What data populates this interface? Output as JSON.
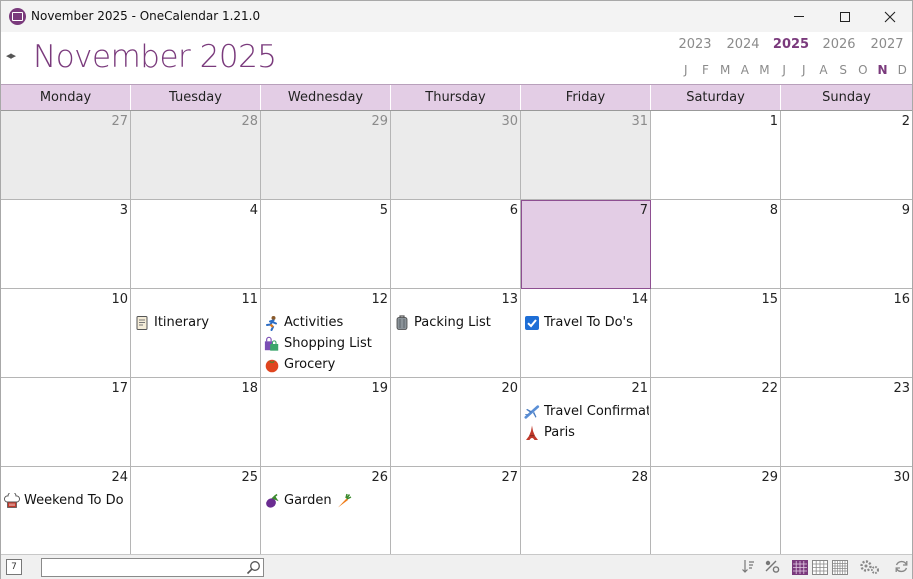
{
  "window": {
    "title": "November 2025 - OneCalendar 1.21.0"
  },
  "header": {
    "month_title": "November 2025",
    "nav_arrows": "◂▸",
    "years": [
      {
        "label": "2023",
        "active": false
      },
      {
        "label": "2024",
        "active": false
      },
      {
        "label": "2025",
        "active": true
      },
      {
        "label": "2026",
        "active": false
      },
      {
        "label": "2027",
        "active": false
      }
    ],
    "months": [
      {
        "label": "J",
        "active": false
      },
      {
        "label": "F",
        "active": false
      },
      {
        "label": "M",
        "active": false
      },
      {
        "label": "A",
        "active": false
      },
      {
        "label": "M",
        "active": false
      },
      {
        "label": "J",
        "active": false
      },
      {
        "label": "J",
        "active": false
      },
      {
        "label": "A",
        "active": false
      },
      {
        "label": "S",
        "active": false
      },
      {
        "label": "O",
        "active": false
      },
      {
        "label": "N",
        "active": true
      },
      {
        "label": "D",
        "active": false
      }
    ]
  },
  "weekdays": [
    "Monday",
    "Tuesday",
    "Wednesday",
    "Thursday",
    "Friday",
    "Saturday",
    "Sunday"
  ],
  "weeks": [
    [
      {
        "day": "27",
        "other": true,
        "events": []
      },
      {
        "day": "28",
        "other": true,
        "events": []
      },
      {
        "day": "29",
        "other": true,
        "events": []
      },
      {
        "day": "30",
        "other": true,
        "events": []
      },
      {
        "day": "31",
        "other": true,
        "events": []
      },
      {
        "day": "1",
        "other": false,
        "events": []
      },
      {
        "day": "2",
        "other": false,
        "events": []
      }
    ],
    [
      {
        "day": "3",
        "other": false,
        "events": []
      },
      {
        "day": "4",
        "other": false,
        "events": []
      },
      {
        "day": "5",
        "other": false,
        "events": []
      },
      {
        "day": "6",
        "other": false,
        "events": []
      },
      {
        "day": "7",
        "other": false,
        "today": true,
        "events": []
      },
      {
        "day": "8",
        "other": false,
        "events": []
      },
      {
        "day": "9",
        "other": false,
        "events": []
      }
    ],
    [
      {
        "day": "10",
        "other": false,
        "events": []
      },
      {
        "day": "11",
        "other": false,
        "events": [
          {
            "icon": "scroll-icon",
            "label": "Itinerary"
          }
        ]
      },
      {
        "day": "12",
        "other": false,
        "events": [
          {
            "icon": "runner-icon",
            "label": "Activities"
          },
          {
            "icon": "shopping-bags-icon",
            "label": "Shopping List"
          },
          {
            "icon": "tomato-icon",
            "label": "Grocery"
          }
        ]
      },
      {
        "day": "13",
        "other": false,
        "events": [
          {
            "icon": "luggage-icon",
            "label": "Packing List"
          }
        ]
      },
      {
        "day": "14",
        "other": false,
        "events": [
          {
            "icon": "checkbox-icon",
            "label": "Travel To Do's"
          }
        ]
      },
      {
        "day": "15",
        "other": false,
        "events": []
      },
      {
        "day": "16",
        "other": false,
        "events": []
      }
    ],
    [
      {
        "day": "17",
        "other": false,
        "events": []
      },
      {
        "day": "18",
        "other": false,
        "events": []
      },
      {
        "day": "19",
        "other": false,
        "events": []
      },
      {
        "day": "20",
        "other": false,
        "events": []
      },
      {
        "day": "21",
        "other": false,
        "events": [
          {
            "icon": "airplane-icon",
            "label": "Travel Confirmat"
          },
          {
            "icon": "eiffel-tower-icon",
            "label": "Paris"
          }
        ]
      },
      {
        "day": "22",
        "other": false,
        "events": []
      },
      {
        "day": "23",
        "other": false,
        "events": []
      }
    ],
    [
      {
        "day": "24",
        "other": false,
        "events": [
          {
            "icon": "chef-hat-icon",
            "label": "Weekend To Do"
          }
        ]
      },
      {
        "day": "25",
        "other": false,
        "events": []
      },
      {
        "day": "26",
        "other": false,
        "events": [
          {
            "icon": "eggplant-icon",
            "label": "Garden",
            "icon2": "carrot-icon"
          }
        ]
      },
      {
        "day": "27",
        "other": false,
        "events": []
      },
      {
        "day": "28",
        "other": false,
        "events": []
      },
      {
        "day": "29",
        "other": false,
        "events": []
      },
      {
        "day": "30",
        "other": false,
        "events": []
      }
    ]
  ],
  "statusbar": {
    "calendar_icon_label": "7",
    "search_placeholder": ""
  },
  "colors": {
    "accent": "#7a3a7c",
    "weekday_header_bg": "#e3cde5",
    "today_bg": "#e3cde5",
    "other_month_bg": "#ebebeb"
  }
}
